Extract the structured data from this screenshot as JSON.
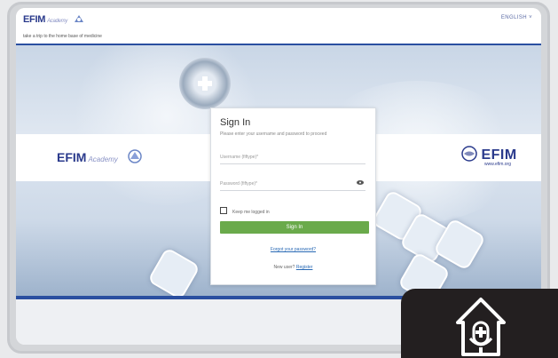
{
  "header": {
    "logo_text": "EFIM",
    "logo_sub": "Academy",
    "language": "ENGLISH ˅"
  },
  "tagline": "take a trip to the home base of medicine",
  "band": {
    "left_logo_text": "EFIM",
    "left_logo_sub": "Academy",
    "right_logo_text": "EFIM",
    "right_logo_url": "www.efim.org"
  },
  "login": {
    "title": "Sign In",
    "subtitle": "Please enter your username and password to proceed",
    "username_placeholder": "Username (fiftype)*",
    "password_placeholder": "Password (fiftype)*",
    "remember_label": "Keep me logged in",
    "submit_label": "Sign In",
    "forgot_label": "Forgot your password?",
    "new_user_prompt": "New user?",
    "register_label": "Register"
  },
  "colors": {
    "brand": "#2a3a8c",
    "accent_bar": "#2a4fa0",
    "button": "#6aaa4b",
    "link": "#2a6ab5"
  }
}
